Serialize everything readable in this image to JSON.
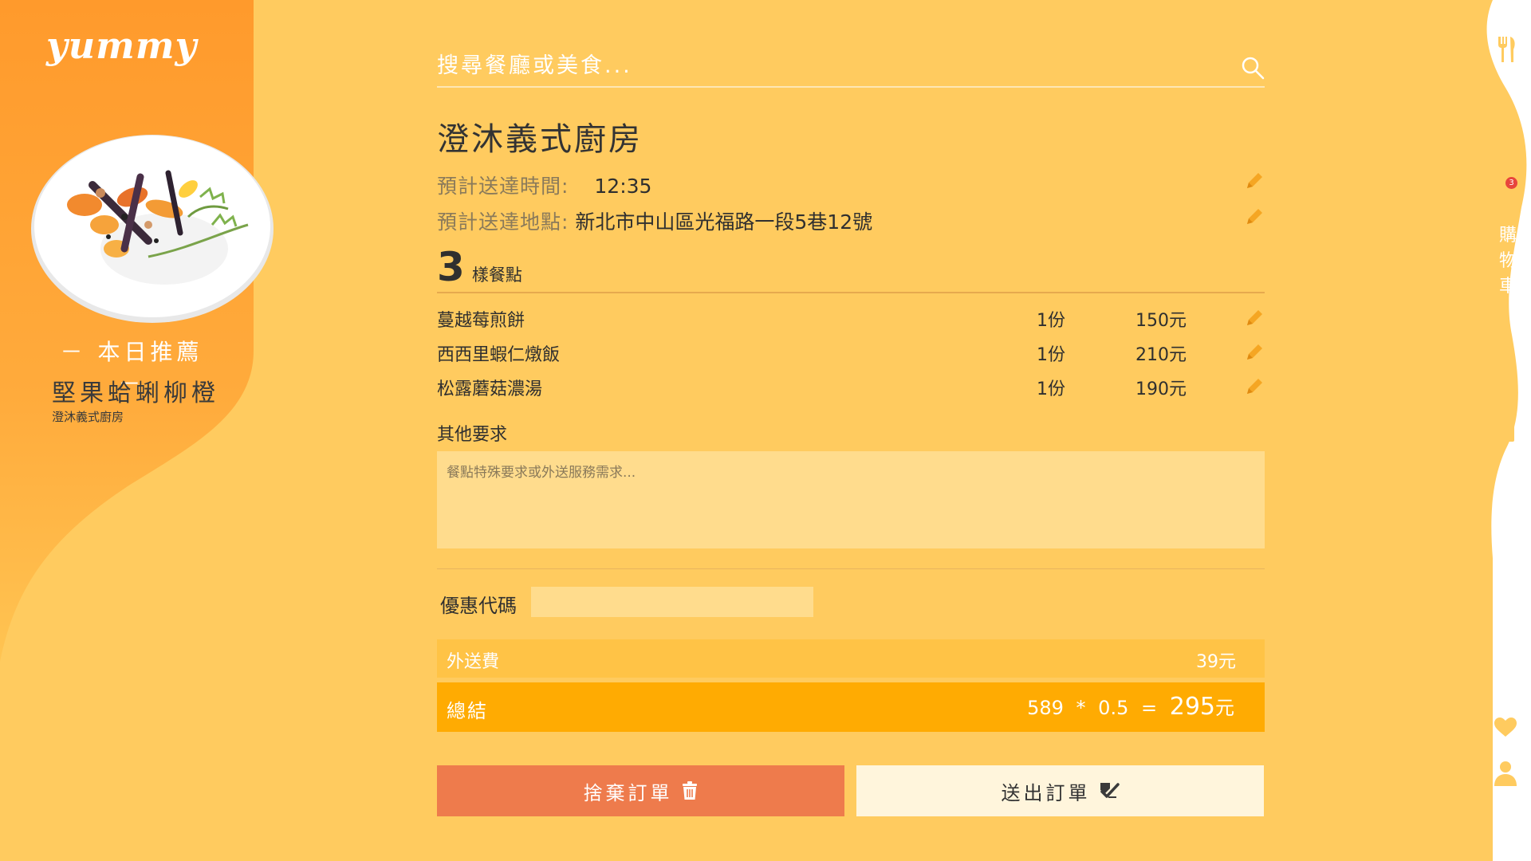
{
  "brand": {
    "logo": "yummy"
  },
  "recommendation": {
    "label": "－ 本日推薦 －",
    "dish_name": "堅果蛤蜊柳橙",
    "restaurant": "澄沐義式廚房"
  },
  "search": {
    "placeholder": "搜尋餐廳或美食..."
  },
  "order": {
    "restaurant_title": "澄沐義式廚房",
    "eta_label": "預計送達時間:",
    "eta_value": "12:35",
    "address_label": "預計送達地點:",
    "address_value": "新北市中山區光福路一段5巷12號",
    "item_count": "3",
    "item_count_suffix": "樣餐點",
    "items": [
      {
        "name": "蔓越莓煎餅",
        "qty": "1份",
        "price": "150元"
      },
      {
        "name": "西西里蝦仁燉飯",
        "qty": "1份",
        "price": "210元"
      },
      {
        "name": "松露蘑菇濃湯",
        "qty": "1份",
        "price": "190元"
      }
    ],
    "notes_label": "其他要求",
    "notes_placeholder": "餐點特殊要求或外送服務需求...",
    "coupon_label": "優惠代碼",
    "delivery_fee_label": "外送費",
    "delivery_fee_value": "39元",
    "total_label": "總結",
    "total_subtotal": "589",
    "total_multiply": "*",
    "total_discount": "0.5",
    "total_equals": "=",
    "total_amount": "295",
    "total_unit": "元"
  },
  "actions": {
    "discard_label": "捨棄訂單",
    "submit_label": "送出訂單"
  },
  "nav": {
    "cart_badge": "3",
    "cart_label": [
      "購",
      "物",
      "車"
    ]
  },
  "colors": {
    "background": "#ffcb5f",
    "sidebar_orange": "#ff9f2f",
    "accent": "#ffab02",
    "discard": "#ee7b4c",
    "pencil": "#f5a623"
  }
}
